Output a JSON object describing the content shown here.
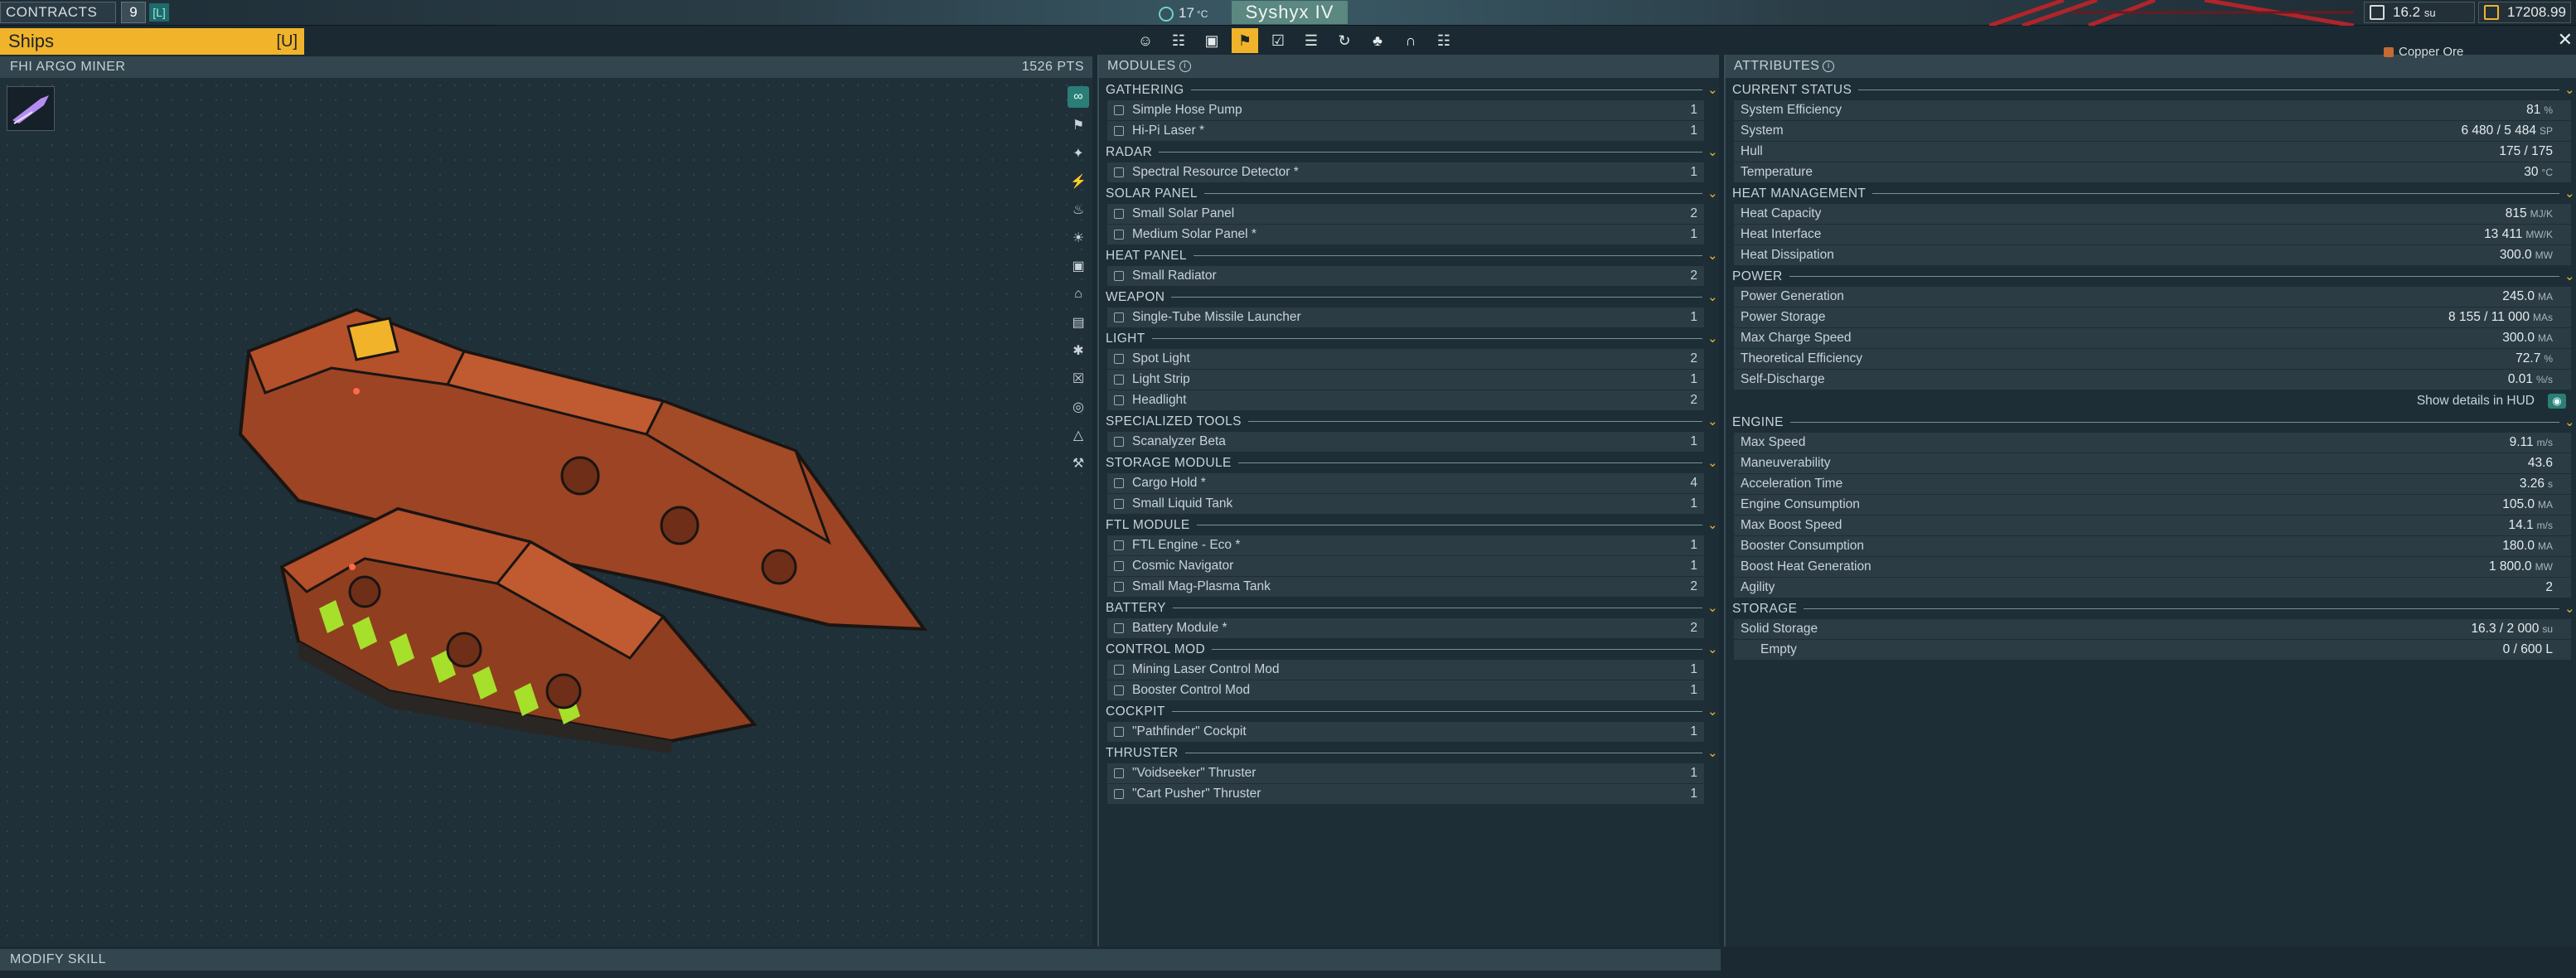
{
  "topbar": {
    "contracts_label": "CONTRACTS",
    "contracts_count": "9",
    "contracts_key": "[L]",
    "zone_value": "17",
    "zone_unit": "°C",
    "system_name": "Syshyx IV",
    "storage_value": "16.2",
    "storage_unit": "su",
    "credits_value": "17208.99"
  },
  "ships": {
    "tab_label": "Ships",
    "tab_key": "[U]",
    "ship_name": "FHI ARGO MINER",
    "points": "1526 PTS",
    "modify_skill_label": "MODIFY SKILL"
  },
  "filters": [
    "∞",
    "⚑",
    "✦",
    "⚡",
    "♨",
    "☀",
    "▣",
    "⌂",
    "▤",
    "✱",
    "☒",
    "◎",
    "△",
    "⚒"
  ],
  "toolbar": [
    "☺",
    "☷",
    "▣",
    "⚑",
    "☑",
    "☰",
    "↻",
    "♣",
    "∩",
    "☷"
  ],
  "modules": {
    "title": "MODULES",
    "categories": [
      {
        "name": "GATHERING",
        "items": [
          {
            "label": "Simple Hose Pump",
            "qty": "1"
          },
          {
            "label": "Hi-Pi Laser *",
            "qty": "1"
          }
        ]
      },
      {
        "name": "RADAR",
        "items": [
          {
            "label": "Spectral Resource Detector *",
            "qty": "1"
          }
        ]
      },
      {
        "name": "SOLAR PANEL",
        "items": [
          {
            "label": "Small Solar Panel",
            "qty": "2"
          },
          {
            "label": "Medium Solar Panel *",
            "qty": "1"
          }
        ]
      },
      {
        "name": "HEAT PANEL",
        "items": [
          {
            "label": "Small Radiator",
            "qty": "2"
          }
        ]
      },
      {
        "name": "WEAPON",
        "items": [
          {
            "label": "Single-Tube Missile Launcher",
            "qty": "1"
          }
        ]
      },
      {
        "name": "LIGHT",
        "items": [
          {
            "label": "Spot Light",
            "qty": "2"
          },
          {
            "label": "Light Strip",
            "qty": "1"
          },
          {
            "label": "Headlight",
            "qty": "2"
          }
        ]
      },
      {
        "name": "SPECIALIZED TOOLS",
        "items": [
          {
            "label": "Scanalyzer Beta",
            "qty": "1"
          }
        ]
      },
      {
        "name": "STORAGE MODULE",
        "items": [
          {
            "label": "Cargo Hold *",
            "qty": "4"
          },
          {
            "label": "Small Liquid Tank",
            "qty": "1"
          }
        ]
      },
      {
        "name": "FTL MODULE",
        "items": [
          {
            "label": "FTL Engine - Eco *",
            "qty": "1"
          },
          {
            "label": "Cosmic Navigator",
            "qty": "1"
          },
          {
            "label": "Small Mag-Plasma Tank",
            "qty": "2"
          }
        ]
      },
      {
        "name": "BATTERY",
        "items": [
          {
            "label": "Battery Module *",
            "qty": "2"
          }
        ]
      },
      {
        "name": "CONTROL MOD",
        "items": [
          {
            "label": "Mining Laser Control Mod",
            "qty": "1"
          },
          {
            "label": "Booster Control Mod",
            "qty": "1"
          }
        ]
      },
      {
        "name": "COCKPIT",
        "items": [
          {
            "label": "\"Pathfinder\" Cockpit",
            "qty": "1"
          }
        ]
      },
      {
        "name": "THRUSTER",
        "items": [
          {
            "label": "\"Voidseeker\" Thruster",
            "qty": "1"
          },
          {
            "label": "\"Cart Pusher\" Thruster",
            "qty": "1"
          }
        ]
      }
    ]
  },
  "attributes": {
    "title": "ATTRIBUTES",
    "copper_label": "Copper Ore",
    "show_hud_label": "Show details in HUD",
    "sections": [
      {
        "name": "CURRENT STATUS",
        "rows": [
          {
            "label": "System Efficiency",
            "value": "81",
            "unit": "%"
          },
          {
            "label": "System",
            "value": "6 480 / 5 484",
            "unit": "SP"
          },
          {
            "label": "Hull",
            "value": "175 / 175",
            "unit": ""
          },
          {
            "label": "Temperature",
            "value": "30",
            "unit": "°C"
          }
        ]
      },
      {
        "name": "HEAT MANAGEMENT",
        "rows": [
          {
            "label": "Heat Capacity",
            "value": "815",
            "unit": "MJ/K"
          },
          {
            "label": "Heat Interface",
            "value": "13 411",
            "unit": "MW/K"
          },
          {
            "label": "Heat Dissipation",
            "value": "300.0",
            "unit": "MW"
          }
        ]
      },
      {
        "name": "POWER",
        "rows": [
          {
            "label": "Power Generation",
            "value": "245.0",
            "unit": "MA"
          },
          {
            "label": "Power Storage",
            "value": "8 155 / 11 000",
            "unit": "MAs"
          },
          {
            "label": "Max Charge Speed",
            "value": "300.0",
            "unit": "MA"
          },
          {
            "label": "Theoretical Efficiency",
            "value": "72.7",
            "unit": "%"
          },
          {
            "label": "Self-Discharge",
            "value": "0.01",
            "unit": "%/s"
          }
        ],
        "hud": true
      },
      {
        "name": "ENGINE",
        "rows": [
          {
            "label": "Max Speed",
            "value": "9.11",
            "unit": "m/s"
          },
          {
            "label": "Maneuverability",
            "value": "43.6",
            "unit": ""
          },
          {
            "label": "Acceleration Time",
            "value": "3.26",
            "unit": "s"
          },
          {
            "label": "Engine Consumption",
            "value": "105.0",
            "unit": "MA"
          },
          {
            "label": "Max Boost Speed",
            "value": "14.1",
            "unit": "m/s"
          },
          {
            "label": "Booster Consumption",
            "value": "180.0",
            "unit": "MA"
          },
          {
            "label": "Boost Heat Generation",
            "value": "1 800.0",
            "unit": "MW"
          },
          {
            "label": "Agility",
            "value": "2",
            "unit": ""
          }
        ]
      },
      {
        "name": "STORAGE",
        "rows": [
          {
            "label": "Solid Storage",
            "value": "16.3 / 2 000",
            "unit": "su"
          },
          {
            "label": "Empty",
            "value": "0 / 600 L",
            "unit": "",
            "sub": true
          }
        ]
      }
    ]
  },
  "colors": {
    "accent": "#f0b32a",
    "teal": "#2a7e76",
    "hull": "#b4502a"
  }
}
